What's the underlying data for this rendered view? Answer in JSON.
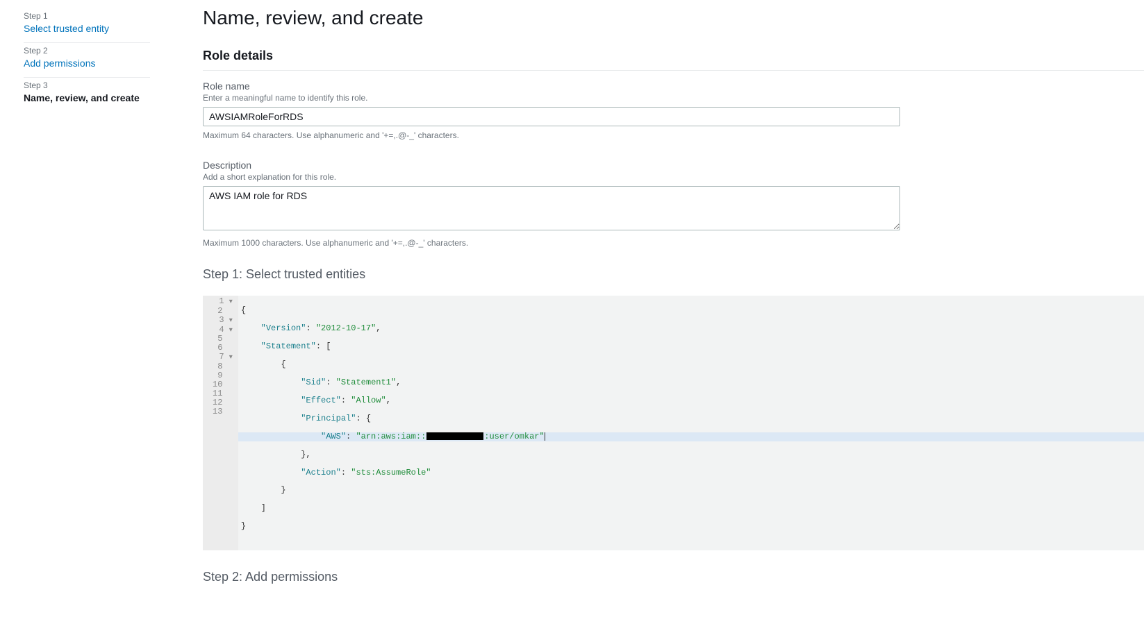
{
  "sidebar": {
    "steps": [
      {
        "label": "Step 1",
        "title": "Select trusted entity",
        "active": false
      },
      {
        "label": "Step 2",
        "title": "Add permissions",
        "active": false
      },
      {
        "label": "Step 3",
        "title": "Name, review, and create",
        "active": true
      }
    ]
  },
  "page": {
    "title": "Name, review, and create",
    "section_role_details": "Role details",
    "role_name": {
      "label": "Role name",
      "hint": "Enter a meaningful name to identify this role.",
      "value": "AWSIAMRoleForRDS",
      "constraint": "Maximum 64 characters. Use alphanumeric and '+=,.@-_' characters."
    },
    "description": {
      "label": "Description",
      "hint": "Add a short explanation for this role.",
      "value": "AWS IAM role for RDS",
      "constraint": "Maximum 1000 characters. Use alphanumeric and '+=,.@-_' characters."
    },
    "step1_heading": "Step 1: Select trusted entities",
    "step2_heading": "Step 2: Add permissions",
    "policy": {
      "lines": [
        {
          "n": "1",
          "fold": true
        },
        {
          "n": "2",
          "fold": false
        },
        {
          "n": "3",
          "fold": true
        },
        {
          "n": "4",
          "fold": true
        },
        {
          "n": "5",
          "fold": false
        },
        {
          "n": "6",
          "fold": false
        },
        {
          "n": "7",
          "fold": true
        },
        {
          "n": "8",
          "fold": false
        },
        {
          "n": "9",
          "fold": false
        },
        {
          "n": "10",
          "fold": false
        },
        {
          "n": "11",
          "fold": false
        },
        {
          "n": "12",
          "fold": false
        },
        {
          "n": "13",
          "fold": false
        }
      ],
      "json": {
        "Version": "2012-10-17",
        "Statement": [
          {
            "Sid": "Statement1",
            "Effect": "Allow",
            "Principal": {
              "AWS": "arn:aws:iam::[REDACTED]:user/omkar"
            },
            "Action": "sts:AssumeRole"
          }
        ]
      },
      "tokens": {
        "l1": "{",
        "l2_k": "\"Version\"",
        "l2_v": "\"2012-10-17\"",
        "l3_k": "\"Statement\"",
        "l5_k": "\"Sid\"",
        "l5_v": "\"Statement1\"",
        "l6_k": "\"Effect\"",
        "l6_v": "\"Allow\"",
        "l7_k": "\"Principal\"",
        "l8_k": "\"AWS\"",
        "l8_v1": "\"arn:aws:iam::",
        "l8_v2": ":user/omkar\"",
        "l10_k": "\"Action\"",
        "l10_v": "\"sts:AssumeRole\""
      }
    }
  }
}
